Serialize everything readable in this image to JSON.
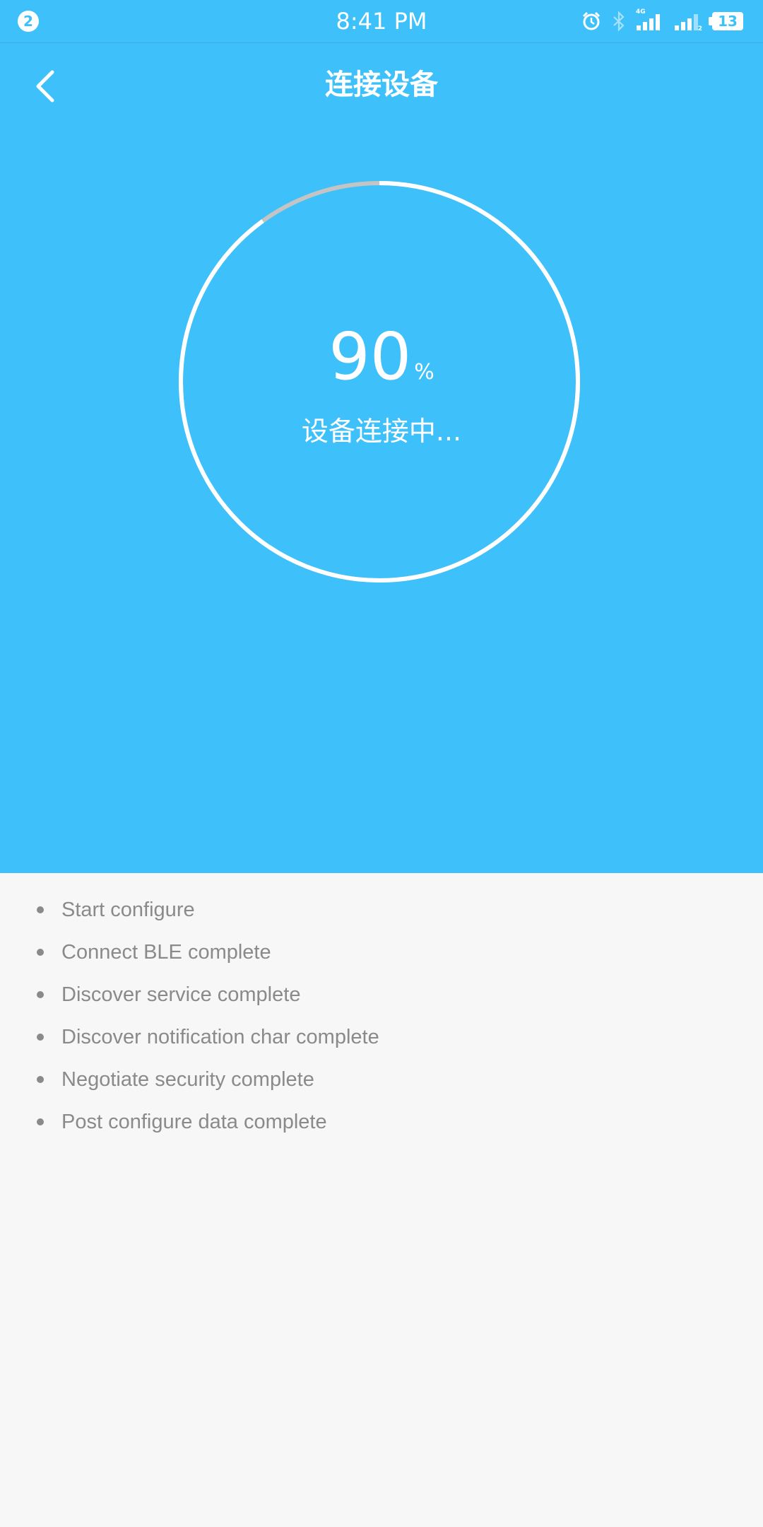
{
  "status_bar": {
    "notification_count": "2",
    "time": "8:41 PM",
    "network_label_1": "4G",
    "network_label_2": "2",
    "battery": "13",
    "icons": [
      "alarm-icon",
      "bluetooth-icon",
      "signal-4g-icon",
      "signal-sim2-icon",
      "battery-icon"
    ]
  },
  "header": {
    "title": "连接设备",
    "back_icon": "chevron-left-icon"
  },
  "progress": {
    "value": "90",
    "unit": "%",
    "fraction": 0.9,
    "status": "设备连接中..."
  },
  "steps": [
    "Start configure",
    "Connect BLE complete",
    "Discover service complete",
    "Discover notification char complete",
    "Negotiate security complete",
    "Post configure data complete"
  ],
  "colors": {
    "primary_background": "#3ec1fb",
    "page_background": "#f7f7f7",
    "step_text": "#8a8a8a",
    "ring_track": "#c4c4c4",
    "ring_progress": "#ffffff"
  }
}
